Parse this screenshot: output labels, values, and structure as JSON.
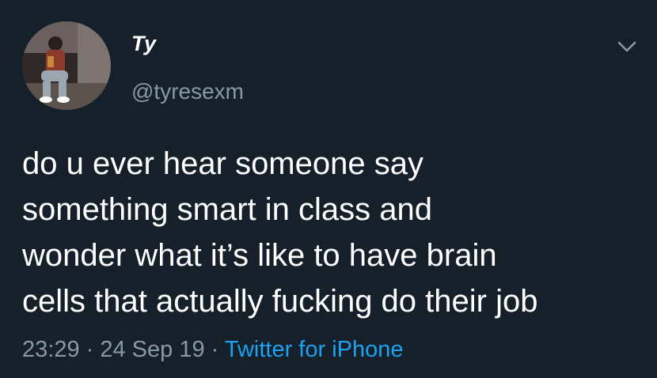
{
  "user": {
    "display_name": "Ty",
    "handle": "@tyresexm",
    "avatar_icon": "profile-photo"
  },
  "tweet": {
    "lines": [
      "do u ever hear someone say",
      "something smart in class and",
      "wonder what it’s like to have brain",
      "cells that actually fucking do their job"
    ],
    "time": "23:29",
    "separator": " · ",
    "date": "24 Sep 19",
    "source": "Twitter for iPhone"
  },
  "icons": {
    "menu": "chevron-down-icon"
  },
  "colors": {
    "background": "#15202b",
    "secondary_text": "#8899a6",
    "link": "#1da1f2"
  }
}
